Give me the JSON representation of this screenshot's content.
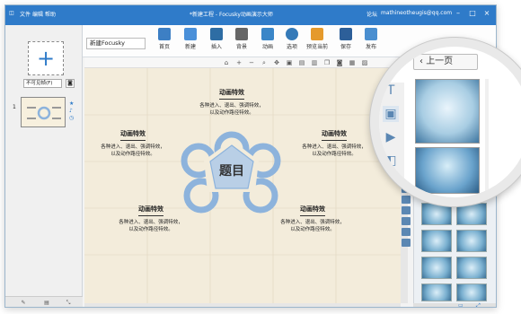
{
  "titlebar": {
    "menu": [
      "文件",
      "编辑",
      "帮助"
    ],
    "title": "*新建工程 - Focusky动画演示大师",
    "forum": "论坛",
    "user": "mathineotheugis@qq.com"
  },
  "toolbar": {
    "doc_name": "新建Focusky",
    "buttons": [
      "首页",
      "新建",
      "插入",
      "背景",
      "动画",
      "选项",
      "预览当前",
      "保存",
      "发布"
    ]
  },
  "left_panel": {
    "transition": "不可见帧(F)",
    "slide_number": "1"
  },
  "canvas": {
    "center_title": "题目",
    "blocks": [
      {
        "heading": "动画特效",
        "body": "各种进入、退出、强调特效，\n以及动作路径特效。"
      },
      {
        "heading": "动画特效",
        "body": "各种进入、退出、强调特效，\n以及动作路径特效。"
      },
      {
        "heading": "动画特效",
        "body": "各种进入、退出、强调特效，\n以及动作路径特效。"
      },
      {
        "heading": "动画特效",
        "body": "各种进入、退出、强调特效，\n以及动作路径特效。"
      },
      {
        "heading": "动画特效",
        "body": "各种进入、退出、强调特效，\n以及动作路径特效。"
      }
    ]
  },
  "magnifier": {
    "prev_label": "上一页"
  },
  "colors": {
    "accent": "#2f7bc9",
    "flower": "#8db3dc",
    "canvas_bg": "#f3ecdb"
  }
}
